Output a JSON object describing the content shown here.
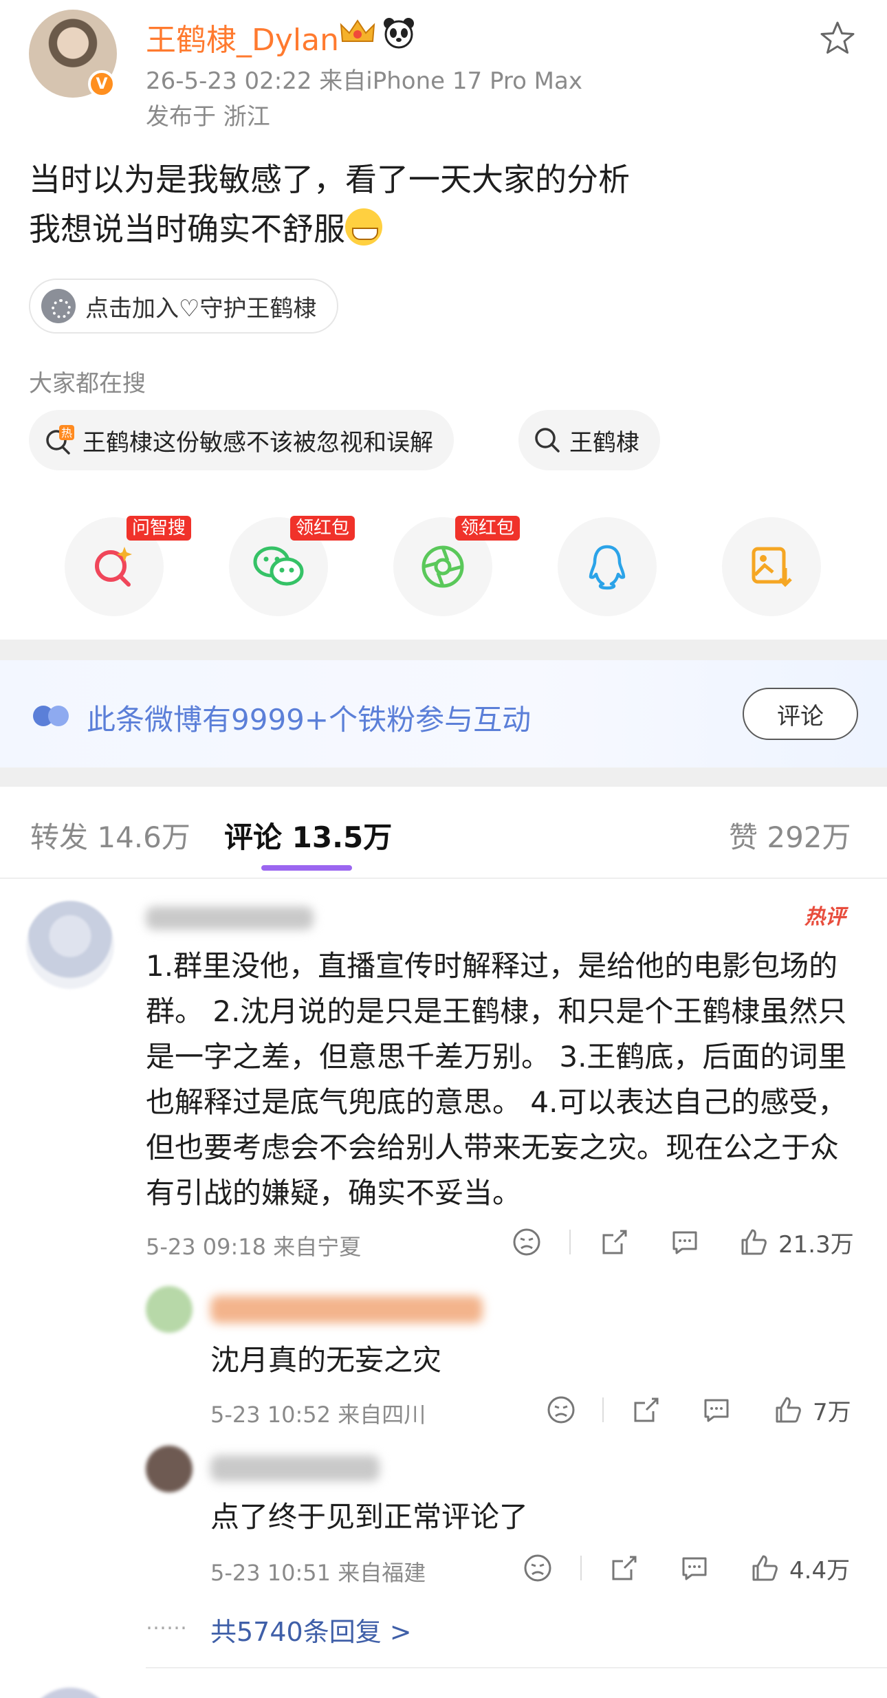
{
  "post": {
    "username": "王鹤棣_Dylan",
    "time_source": "26-5-23 02:22  来自iPhone 17 Pro Max",
    "location": "发布于 浙江",
    "text_line1": "当时以为是我敏感了，看了一天大家的分析",
    "text_line2": "我想说当时确实不舒服",
    "join_label": "点击加入♡守护王鹤棣"
  },
  "search": {
    "heading": "大家都在搜",
    "chip1": "王鹤棣这份敏感不该被忽视和误解",
    "chip1_hot": "热",
    "chip2": "王鹤棣"
  },
  "share": {
    "badge1": "问智搜",
    "badge2": "领红包",
    "badge3": "领红包"
  },
  "fan_banner": {
    "text": "此条微博有9999+个铁粉参与互动",
    "button": "评论"
  },
  "tabs": {
    "repost": "转发 14.6万",
    "comment": "评论 13.5万",
    "like": "赞 292万"
  },
  "comments": {
    "top": {
      "hot_tag": "热评",
      "text": "1.群里没他，直播宣传时解释过，是给他的电影包场的群。 2.沈月说的是只是王鹤棣，和只是个王鹤棣虽然只是一字之差，但意思千差万别。 3.王鹤底，后面的词里也解释过是底气兜底的意思。 4.可以表达自己的感受，但也要考虑会不会给别人带来无妄之灾。现在公之于众有引战的嫌疑，确实不妥当。",
      "meta": "5-23 09:18  来自宁夏",
      "likes": "21.3万"
    },
    "reply1": {
      "text": "沈月真的无妄之灾",
      "meta": "5-23 10:52  来自四川",
      "likes": "7万"
    },
    "reply2": {
      "text": "点了终于见到正常评论了",
      "meta": "5-23 10:51  来自福建",
      "likes": "4.4万"
    },
    "total_replies": "共5740条回复 >",
    "dots": "……"
  },
  "colors": {
    "username": "#ff7a2f",
    "tab_indicator": "#9b66f0",
    "link_blue": "#3f5fa8",
    "fan_text": "#5b7fd8",
    "badge_red": "#f0322a"
  }
}
